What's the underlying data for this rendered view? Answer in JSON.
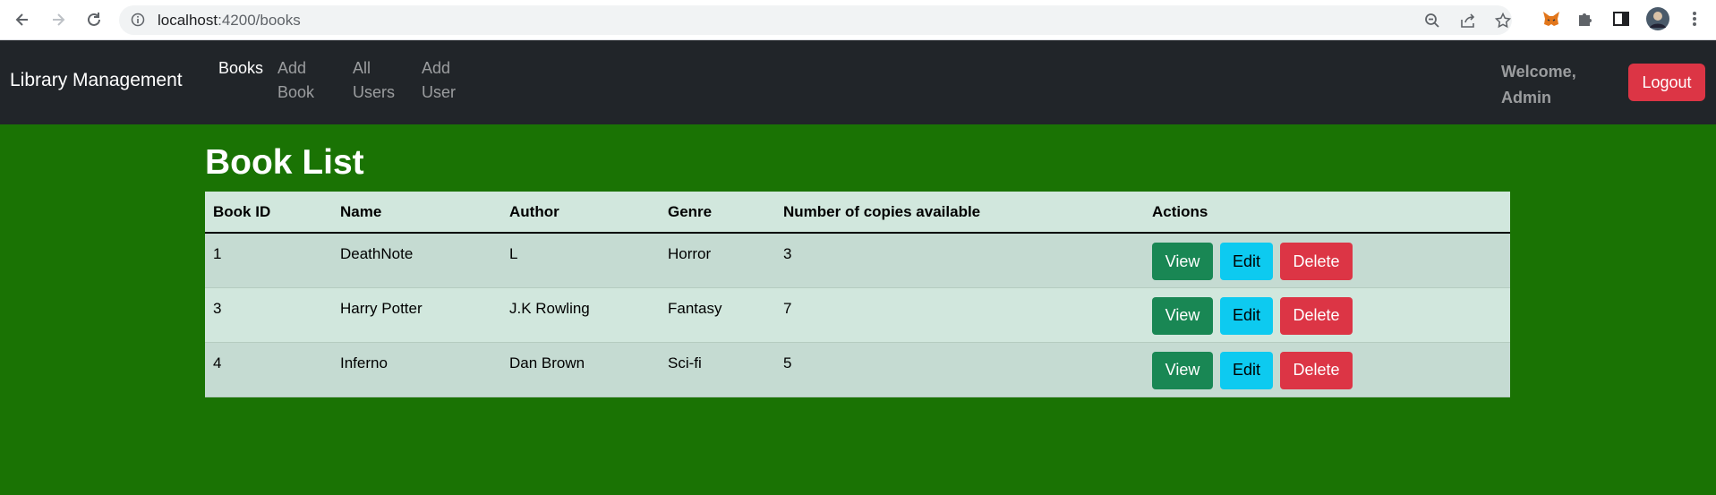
{
  "browser": {
    "url_host": "localhost",
    "url_path": ":4200/books"
  },
  "navbar": {
    "brand": "Library Management",
    "links": [
      {
        "label": "Books",
        "active": true
      },
      {
        "label": "Add Book",
        "active": false
      },
      {
        "label": "All Users",
        "active": false
      },
      {
        "label": "Add User",
        "active": false
      }
    ],
    "welcome": "Welcome, Admin",
    "logout_label": "Logout"
  },
  "main": {
    "title": "Book List",
    "columns": [
      "Book ID",
      "Name",
      "Author",
      "Genre",
      "Number of copies available",
      "Actions"
    ],
    "rows": [
      {
        "id": "1",
        "name": "DeathNote",
        "author": "L",
        "genre": "Horror",
        "copies": "3"
      },
      {
        "id": "3",
        "name": "Harry Potter",
        "author": "J.K Rowling",
        "genre": "Fantasy",
        "copies": "7"
      },
      {
        "id": "4",
        "name": "Inferno",
        "author": "Dan Brown",
        "genre": "Sci-fi",
        "copies": "5"
      }
    ],
    "actions": {
      "view": "View",
      "edit": "Edit",
      "delete": "Delete"
    }
  },
  "colors": {
    "background": "#1a7304",
    "navbar": "#212529",
    "view": "#198754",
    "edit": "#0dcaf0",
    "delete": "#dc3545"
  }
}
